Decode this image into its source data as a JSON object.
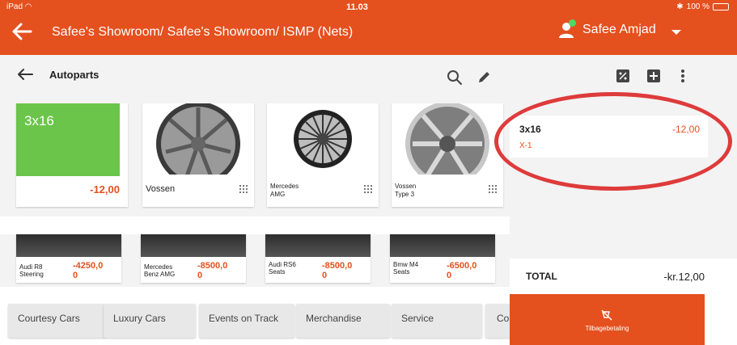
{
  "status_bar": {
    "device": "iPad",
    "time": "11.03",
    "battery": "100 %"
  },
  "header": {
    "title": "Safee's Showroom/ Safee's Showroom/ ISMP (Nets)",
    "user_name": "Safee Amjad"
  },
  "section": {
    "title": "Autoparts"
  },
  "tiles_row1": [
    {
      "name": "3x16",
      "price": "-12,00",
      "color": "#6bc54a"
    },
    {
      "name": "Vossen"
    },
    {
      "name": "Mercedes\nAMG"
    },
    {
      "name": "Vossen\nType 3"
    }
  ],
  "tiles_row2": [
    {
      "name": "Audi R8\nSteering",
      "price": "-4250,0\n0"
    },
    {
      "name": "Mercedes\nBenz AMG",
      "price": "-8500,0\n0"
    },
    {
      "name": "Audi RS6\nSeats",
      "price": "-8500,0\n0"
    },
    {
      "name": "Bmw M4\nSeats",
      "price": "-6500,0\n0"
    }
  ],
  "categories": [
    "Courtesy Cars",
    "Luxury Cars",
    "Events on Track",
    "Merchandise",
    "Service",
    "Cor"
  ],
  "order": {
    "item_name": "3x16",
    "item_price": "-12,00",
    "item_sub": "X-1"
  },
  "total": {
    "label": "TOTAL",
    "value": "-kr.12,00"
  },
  "refund_button": {
    "label": "Tilbagebetaling"
  },
  "colors": {
    "accent": "#e5501f",
    "green": "#6bc54a",
    "ring": "#de3b3b"
  }
}
